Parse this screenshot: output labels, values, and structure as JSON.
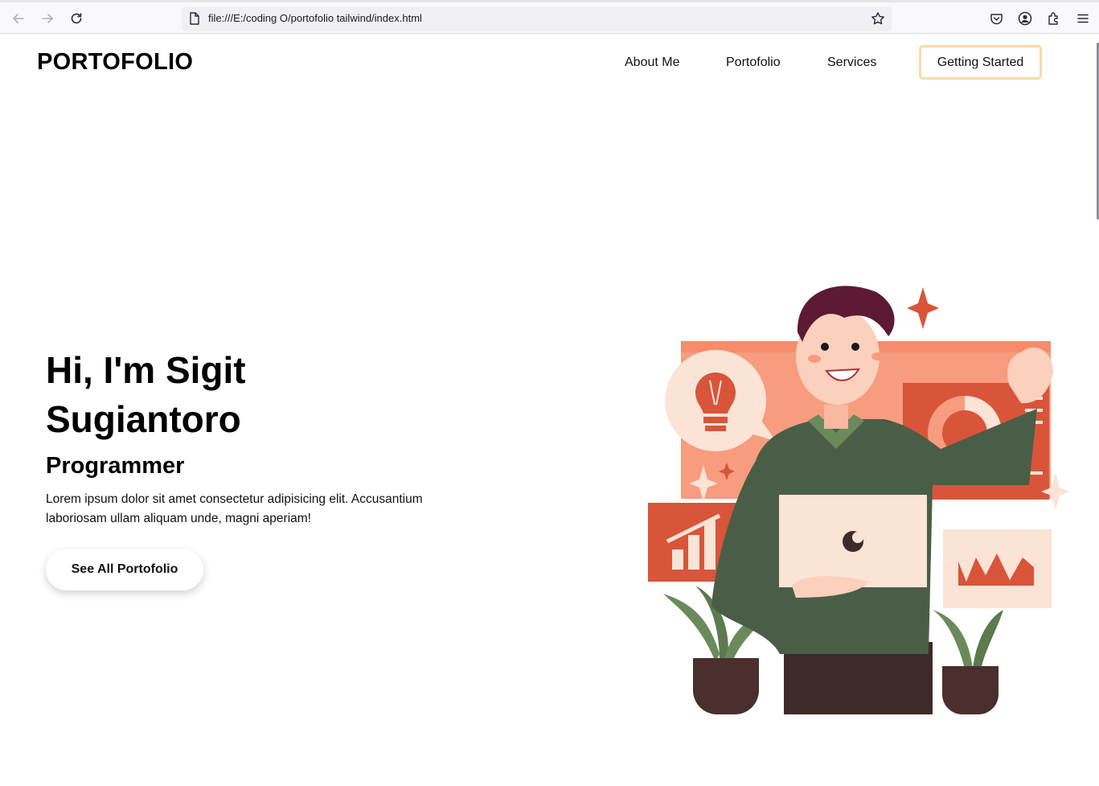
{
  "browser": {
    "url": "file:///E:/coding O/portofolio tailwind/index.html"
  },
  "header": {
    "logo": "PORTOFOLIO",
    "nav": [
      {
        "label": "About Me"
      },
      {
        "label": "Portofolio"
      },
      {
        "label": "Services"
      }
    ],
    "cta_label": "Getting Started"
  },
  "hero": {
    "title": "Hi, I'm Sigit Sugiantoro",
    "role": "Programmer",
    "description": "Lorem ipsum dolor sit amet consectetur adipisicing elit. Accusantium laboriosam ullam aliquam unde, magni aperiam!",
    "button_label": "See All Portofolio"
  },
  "colors": {
    "accent_border": "#fcd9a8",
    "illustration_coral": "#f79c7e",
    "illustration_red": "#d8553a",
    "sweater_green": "#4a5e47"
  },
  "icons": [
    "back-arrow-icon",
    "forward-arrow-icon",
    "reload-icon",
    "page-icon",
    "bookmark-star-icon",
    "pocket-icon",
    "account-icon",
    "extensions-icon",
    "menu-icon"
  ]
}
